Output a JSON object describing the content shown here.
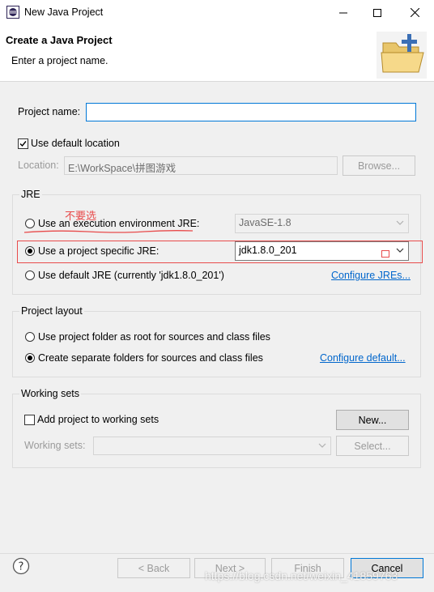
{
  "window": {
    "title": "New Java Project"
  },
  "header": {
    "title": "Create a Java Project",
    "description": "Enter a project name."
  },
  "project": {
    "name_label": "Project name:",
    "name_value": "",
    "use_default_location_label": "Use default location",
    "use_default_location_checked": true,
    "location_label": "Location:",
    "location_value": "E:\\WorkSpace\\拼图游戏",
    "browse_label": "Browse..."
  },
  "jre": {
    "group_label": "JRE",
    "annotation": "不要选",
    "option_execution_env_label": "Use an execution environment JRE:",
    "execution_env_value": "JavaSE-1.8",
    "option_project_specific_label": "Use a project specific JRE:",
    "project_specific_value": "jdk1.8.0_201",
    "option_default_label": "Use default JRE (currently 'jdk1.8.0_201')",
    "configure_link": "Configure JREs...",
    "selected": "project_specific"
  },
  "layout": {
    "group_label": "Project layout",
    "option_root_label": "Use project folder as root for sources and class files",
    "option_separate_label": "Create separate folders for sources and class files",
    "configure_link": "Configure default...",
    "selected": "separate"
  },
  "working_sets": {
    "group_label": "Working sets",
    "add_label": "Add project to working sets",
    "add_checked": false,
    "new_button": "New...",
    "sets_label": "Working sets:",
    "sets_value": "",
    "select_button": "Select..."
  },
  "footer": {
    "back_button": "< Back",
    "next_button": "Next >",
    "finish_button": "Finish",
    "cancel_button": "Cancel",
    "watermark": "https://blog.csdn.net/weixin_41859763"
  },
  "colors": {
    "annotation_red": "#e84b4b",
    "link_blue": "#0066cc",
    "focus_blue": "#0078d7"
  }
}
